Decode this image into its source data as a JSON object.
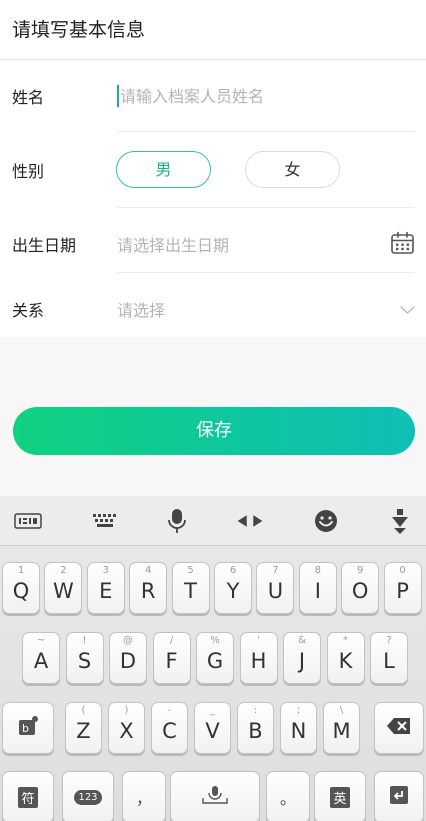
{
  "header": {
    "title": "请填写基本信息"
  },
  "form": {
    "name": {
      "label": "姓名",
      "placeholder": "请输入档案人员姓名"
    },
    "gender": {
      "label": "性别",
      "options": [
        "男",
        "女"
      ],
      "selected": "男"
    },
    "birthdate": {
      "label": "出生日期",
      "placeholder": "请选择出生日期"
    },
    "relation": {
      "label": "关系",
      "placeholder": "请选择"
    }
  },
  "save_button": {
    "label": "保存"
  },
  "keyboard": {
    "toolbar": [
      "ime-logo-icon",
      "keyboard-icon",
      "microphone-icon",
      "cursor-arrows-icon",
      "emoji-icon",
      "collapse-keyboard-icon"
    ],
    "row1": [
      {
        "main": "Q",
        "sub": "1"
      },
      {
        "main": "W",
        "sub": "2"
      },
      {
        "main": "E",
        "sub": "3"
      },
      {
        "main": "R",
        "sub": "4"
      },
      {
        "main": "T",
        "sub": "5"
      },
      {
        "main": "Y",
        "sub": "6"
      },
      {
        "main": "U",
        "sub": "7"
      },
      {
        "main": "I",
        "sub": "8"
      },
      {
        "main": "O",
        "sub": "9"
      },
      {
        "main": "P",
        "sub": "0"
      }
    ],
    "row2": [
      {
        "main": "A",
        "sub": "~"
      },
      {
        "main": "S",
        "sub": "!"
      },
      {
        "main": "D",
        "sub": "@"
      },
      {
        "main": "F",
        "sub": "/"
      },
      {
        "main": "G",
        "sub": "%"
      },
      {
        "main": "H",
        "sub": "'"
      },
      {
        "main": "J",
        "sub": "&"
      },
      {
        "main": "K",
        "sub": "*"
      },
      {
        "main": "L",
        "sub": "?"
      }
    ],
    "row3": [
      {
        "main": "Z",
        "sub": "("
      },
      {
        "main": "X",
        "sub": ")"
      },
      {
        "main": "C",
        "sub": "-"
      },
      {
        "main": "V",
        "sub": "_"
      },
      {
        "main": "B",
        "sub": ":"
      },
      {
        "main": "N",
        "sub": ";"
      },
      {
        "main": "M",
        "sub": "\\"
      }
    ],
    "symbols_key": "符",
    "numbers_key": "123",
    "comma_key": "，",
    "period_key": "。",
    "language_key": "英"
  }
}
